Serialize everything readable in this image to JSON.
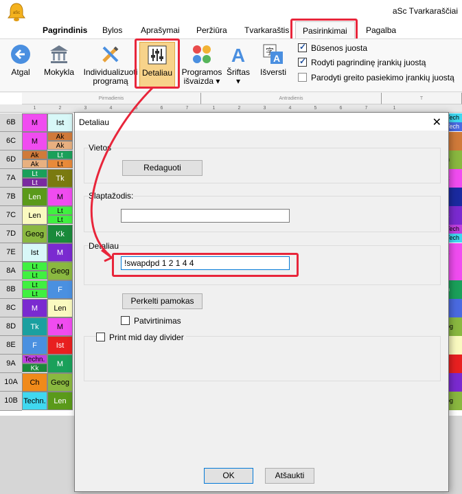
{
  "window": {
    "title": "aSc Tvarkaraščiai",
    "logo_text": "aSc"
  },
  "tabs": [
    {
      "label": "Pagrindinis"
    },
    {
      "label": "Bylos"
    },
    {
      "label": "Aprašymai"
    },
    {
      "label": "Peržiūra"
    },
    {
      "label": "Tvarkaraštis"
    },
    {
      "label": "Pasirinkimai"
    },
    {
      "label": "Pagalba"
    }
  ],
  "ribbon": {
    "buttons": [
      {
        "label": "Atgal",
        "icon": "back-arrow-icon"
      },
      {
        "label": "Mokykla",
        "icon": "school-building-icon"
      },
      {
        "label": "Individualizuoti programą",
        "line1": "Individualizuoti",
        "line2": "programą",
        "icon": "tools-icon"
      },
      {
        "label": "Detaliau",
        "icon": "sliders-icon"
      },
      {
        "label": "Programos išvaizda",
        "line1": "Programos",
        "line2": "išvaizda",
        "icon": "color-palette-icon"
      },
      {
        "label": "Šriftas",
        "icon": "font-icon"
      },
      {
        "label": "Išversti",
        "icon": "translate-icon"
      }
    ],
    "checkboxes": [
      {
        "label": "Būsenos juosta",
        "checked": true
      },
      {
        "label": "Rodyti pagrindinę įrankių juostą",
        "checked": true
      },
      {
        "label": "Parodyti greito pasiekimo įrankių juostą",
        "checked": false
      }
    ]
  },
  "grid": {
    "days": [
      "Pirmadienis",
      "Antradienis",
      "T"
    ],
    "periods": [
      "1",
      "2",
      "3",
      "4",
      "5",
      "6",
      "7",
      "1",
      "2",
      "3",
      "4",
      "5",
      "6",
      "7",
      "1"
    ],
    "rows": [
      {
        "cls": "6B",
        "c1": "M",
        "c2": "Ist"
      },
      {
        "cls": "6C",
        "c1": "M",
        "c2a": "Ak",
        "c2b": "Ak"
      },
      {
        "cls": "6D",
        "c1a": "Ak",
        "c1b": "Ak",
        "c2a": "Lt",
        "c2b": "Lt"
      },
      {
        "cls": "7A",
        "c1a": "Lt",
        "c1b": "Lt",
        "c2": "Tk"
      },
      {
        "cls": "7B",
        "c1": "Len",
        "c2": "M"
      },
      {
        "cls": "7C",
        "c1": "Len",
        "c2a": "Lt",
        "c2b": "Lt"
      },
      {
        "cls": "7D",
        "c1": "Geog",
        "c2": "Kk"
      },
      {
        "cls": "7E",
        "c1": "Ist",
        "c2": "M"
      },
      {
        "cls": "8A",
        "c1a": "Lt",
        "c1b": "Lt",
        "c2": "Geog"
      },
      {
        "cls": "8B",
        "c1a": "Lt",
        "c1b": "Lt",
        "c2": "F"
      },
      {
        "cls": "8C",
        "c1": "M",
        "c2": "Len"
      },
      {
        "cls": "8D",
        "c1": "Tk",
        "c2": "M"
      },
      {
        "cls": "8E",
        "c1": "F",
        "c2": "Ist"
      },
      {
        "cls": "9A",
        "c1a": "Techn.",
        "c1b": "Kk",
        "c2": "M"
      },
      {
        "cls": "10A",
        "c1": "Ch",
        "c2": "Geog"
      },
      {
        "cls": "10B",
        "c1": "Techn.",
        "c2": "Len"
      }
    ],
    "right_strip": [
      "Tech",
      "Tech",
      "f",
      "n",
      "k",
      "k",
      "Tech",
      "Tech",
      "k",
      "n",
      "og",
      "og"
    ]
  },
  "dialog": {
    "title": "Detaliau",
    "vietos_label": "Vietos",
    "edit_button": "Redaguoti",
    "password_label": "Slaptažodis:",
    "password_value": "",
    "detail_label": "Detaliau",
    "detail_value": "!swapdpd 1 2 1 4 4",
    "move_button": "Perkelti pamokas",
    "confirm_label": "Patvirtinimas",
    "confirm_checked": false,
    "print_label": "Print mid day divider",
    "print_checked": false,
    "ok_button": "OK",
    "cancel_button": "Atšaukti"
  }
}
